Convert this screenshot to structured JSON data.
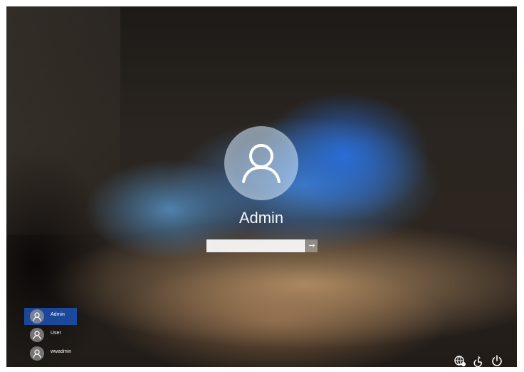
{
  "login": {
    "username": "Admin",
    "password_value": "",
    "submit_glyph": "→"
  },
  "user_list": [
    {
      "name": "Admin",
      "selected": true
    },
    {
      "name": "User",
      "selected": false
    },
    {
      "name": "wwadmin",
      "selected": false
    }
  ],
  "system_icons": [
    "network-icon",
    "ease-of-access-icon",
    "power-icon"
  ],
  "colors": {
    "selected_user": "#1e5ac8",
    "accent_blue": "#2a6fd6"
  }
}
